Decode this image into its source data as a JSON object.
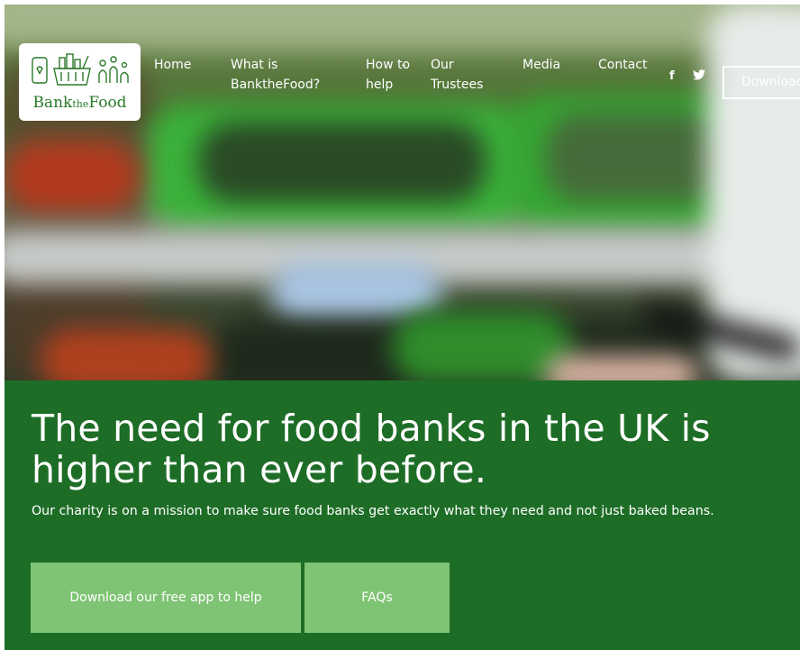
{
  "logo": {
    "text_main_1": "Bank",
    "text_small": "the",
    "text_main_2": "Food",
    "icons": [
      "phone-heart-icon",
      "shopping-basket-icon",
      "family-icon"
    ]
  },
  "nav": {
    "home": "Home",
    "what_is": "What is BanktheFood?",
    "how_to_help": "How to help",
    "how_chevron": "⌄",
    "trustees": "Our Trustees",
    "media": "Media",
    "contact": "Contact",
    "facebook": "f",
    "twitter": "🐦",
    "download": "Download"
  },
  "hero_section": {
    "headline": "The need for food banks in the UK is higher than ever before.",
    "subline": "Our charity is on a mission to make sure food banks get exactly what they need and not just baked beans.",
    "button_app": "Download our free app to help",
    "button_faq": "FAQs"
  },
  "colors": {
    "brand_green": "#1e6d27",
    "button_green": "#7fc474",
    "logo_green": "#2a7a2a"
  }
}
